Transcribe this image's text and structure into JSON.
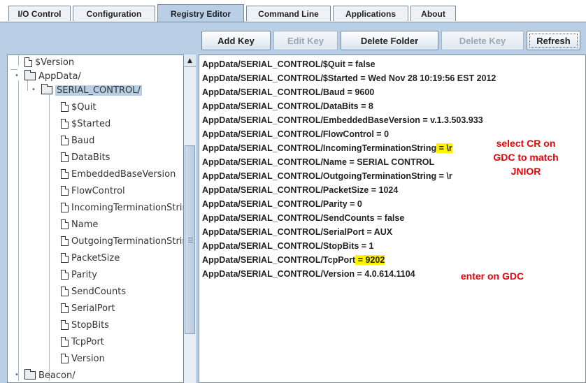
{
  "tabs": [
    {
      "label": "I/O Control"
    },
    {
      "label": "Configuration"
    },
    {
      "label": "Registry Editor"
    },
    {
      "label": "Command Line"
    },
    {
      "label": "Applications"
    },
    {
      "label": "About"
    }
  ],
  "toolbar": {
    "add_key": "Add Key",
    "edit_key": "Edit Key",
    "delete_folder": "Delete Folder",
    "delete_key": "Delete Key",
    "refresh": "Refresh"
  },
  "tree": {
    "version_top": "$Version",
    "appdata": "AppData/",
    "serial_control": "SERIAL_CONTROL/",
    "keys": [
      "$Quit",
      "$Started",
      "Baud",
      "DataBits",
      "EmbeddedBaseVersion",
      "FlowControl",
      "IncomingTerminationString",
      "Name",
      "OutgoingTerminationString",
      "PacketSize",
      "Parity",
      "SendCounts",
      "SerialPort",
      "StopBits",
      "TcpPort",
      "Version"
    ],
    "beacon": "Beacon/"
  },
  "entries": [
    "AppData/SERIAL_CONTROL/$Quit = false",
    "AppData/SERIAL_CONTROL/$Started = Wed Nov 28 10:19:56 EST 2012",
    "AppData/SERIAL_CONTROL/Baud = 9600",
    "AppData/SERIAL_CONTROL/DataBits = 8",
    "AppData/SERIAL_CONTROL/EmbeddedBaseVersion = v.1.3.503.933",
    "AppData/SERIAL_CONTROL/FlowControl = 0",
    "AppData/SERIAL_CONTROL/IncomingTerminationString",
    "AppData/SERIAL_CONTROL/Name = SERIAL CONTROL",
    "AppData/SERIAL_CONTROL/OutgoingTerminationString = \\r",
    "AppData/SERIAL_CONTROL/PacketSize = 1024",
    "AppData/SERIAL_CONTROL/Parity = 0",
    "AppData/SERIAL_CONTROL/SendCounts = false",
    "AppData/SERIAL_CONTROL/SerialPort = AUX",
    "AppData/SERIAL_CONTROL/StopBits = 1",
    "AppData/SERIAL_CONTROL/TcpPort",
    "AppData/SERIAL_CONTROL/Version = 4.0.614.1104"
  ],
  "highlights": {
    "incoming_value": " = \\r",
    "tcpport_value": " = 9202"
  },
  "annotations": {
    "cr_note_line1": "select CR on",
    "cr_note_line2": "GDC to match",
    "cr_note_line3": "JNIOR",
    "tcp_note": "enter on GDC"
  },
  "colors": {
    "panel": "#b8cfe5",
    "highlight": "#fff200",
    "annotation": "#e8000a"
  }
}
